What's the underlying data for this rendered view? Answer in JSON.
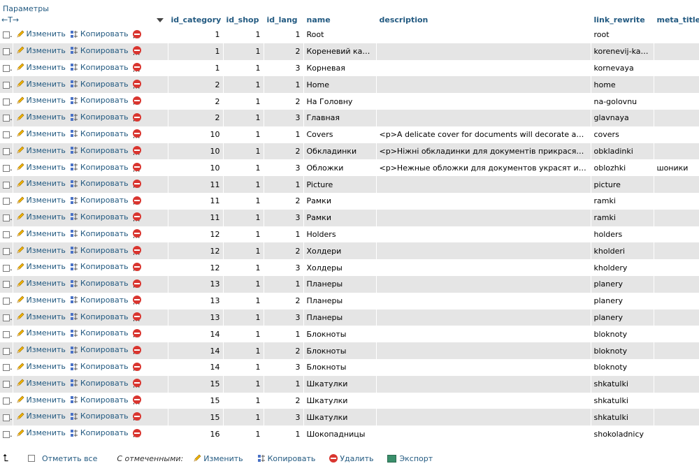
{
  "header": {
    "options_label": "Параметры",
    "resize_arrows": "←T→"
  },
  "columns": [
    "id_category",
    "id_shop",
    "id_lang",
    "name",
    "description",
    "link_rewrite",
    "meta_title"
  ],
  "actions": {
    "edit": "Изменить",
    "copy": "Копировать",
    "delete": "Удалить"
  },
  "rows": [
    {
      "id_category": "1",
      "id_shop": "1",
      "id_lang": "1",
      "name": "Root",
      "description": "",
      "link_rewrite": "root",
      "meta_title": ""
    },
    {
      "id_category": "1",
      "id_shop": "1",
      "id_lang": "2",
      "name": "Кореневий каталог",
      "description": "",
      "link_rewrite": "korenevij-katalog",
      "meta_title": ""
    },
    {
      "id_category": "1",
      "id_shop": "1",
      "id_lang": "3",
      "name": "Корневая",
      "description": "",
      "link_rewrite": "kornevaya",
      "meta_title": ""
    },
    {
      "id_category": "2",
      "id_shop": "1",
      "id_lang": "1",
      "name": "Home",
      "description": "",
      "link_rewrite": "home",
      "meta_title": ""
    },
    {
      "id_category": "2",
      "id_shop": "1",
      "id_lang": "2",
      "name": "На Головну",
      "description": "",
      "link_rewrite": "na-golovnu",
      "meta_title": ""
    },
    {
      "id_category": "2",
      "id_shop": "1",
      "id_lang": "3",
      "name": "Главная",
      "description": "",
      "link_rewrite": "glavnaya",
      "meta_title": ""
    },
    {
      "id_category": "10",
      "id_shop": "1",
      "id_lang": "1",
      "name": "Covers",
      "description": "<p>A delicate cover for documents will decorate an...",
      "link_rewrite": "covers",
      "meta_title": ""
    },
    {
      "id_category": "10",
      "id_shop": "1",
      "id_lang": "2",
      "name": "Обкладинки",
      "description": "<p>Ніжні обкладинки для документів прикрасять і за...",
      "link_rewrite": "obkladinki",
      "meta_title": ""
    },
    {
      "id_category": "10",
      "id_shop": "1",
      "id_lang": "3",
      "name": "Обложки",
      "description": "<p>Нежные обложки для документов украсят и защитят...",
      "link_rewrite": "oblozhki",
      "meta_title": "шоники"
    },
    {
      "id_category": "11",
      "id_shop": "1",
      "id_lang": "1",
      "name": "Picture",
      "description": "",
      "link_rewrite": "picture",
      "meta_title": ""
    },
    {
      "id_category": "11",
      "id_shop": "1",
      "id_lang": "2",
      "name": "Рамки",
      "description": "",
      "link_rewrite": "ramki",
      "meta_title": ""
    },
    {
      "id_category": "11",
      "id_shop": "1",
      "id_lang": "3",
      "name": "Рамки",
      "description": "",
      "link_rewrite": "ramki",
      "meta_title": ""
    },
    {
      "id_category": "12",
      "id_shop": "1",
      "id_lang": "1",
      "name": "Holders",
      "description": "",
      "link_rewrite": "holders",
      "meta_title": ""
    },
    {
      "id_category": "12",
      "id_shop": "1",
      "id_lang": "2",
      "name": "Холдери",
      "description": "",
      "link_rewrite": "kholderi",
      "meta_title": ""
    },
    {
      "id_category": "12",
      "id_shop": "1",
      "id_lang": "3",
      "name": "Холдеры",
      "description": "",
      "link_rewrite": "kholdery",
      "meta_title": ""
    },
    {
      "id_category": "13",
      "id_shop": "1",
      "id_lang": "1",
      "name": "Планеры",
      "description": "",
      "link_rewrite": "planery",
      "meta_title": ""
    },
    {
      "id_category": "13",
      "id_shop": "1",
      "id_lang": "2",
      "name": "Планеры",
      "description": "",
      "link_rewrite": "planery",
      "meta_title": ""
    },
    {
      "id_category": "13",
      "id_shop": "1",
      "id_lang": "3",
      "name": "Планеры",
      "description": "",
      "link_rewrite": "planery",
      "meta_title": ""
    },
    {
      "id_category": "14",
      "id_shop": "1",
      "id_lang": "1",
      "name": "Блокноты",
      "description": "",
      "link_rewrite": "bloknoty",
      "meta_title": ""
    },
    {
      "id_category": "14",
      "id_shop": "1",
      "id_lang": "2",
      "name": "Блокноты",
      "description": "",
      "link_rewrite": "bloknoty",
      "meta_title": ""
    },
    {
      "id_category": "14",
      "id_shop": "1",
      "id_lang": "3",
      "name": "Блокноты",
      "description": "",
      "link_rewrite": "bloknoty",
      "meta_title": ""
    },
    {
      "id_category": "15",
      "id_shop": "1",
      "id_lang": "1",
      "name": "Шкатулки",
      "description": "",
      "link_rewrite": "shkatulki",
      "meta_title": ""
    },
    {
      "id_category": "15",
      "id_shop": "1",
      "id_lang": "2",
      "name": "Шкатулки",
      "description": "",
      "link_rewrite": "shkatulki",
      "meta_title": ""
    },
    {
      "id_category": "15",
      "id_shop": "1",
      "id_lang": "3",
      "name": "Шкатулки",
      "description": "",
      "link_rewrite": "shkatulki",
      "meta_title": ""
    },
    {
      "id_category": "16",
      "id_shop": "1",
      "id_lang": "1",
      "name": "Шокопадницы",
      "description": "",
      "link_rewrite": "shokoladnicy",
      "meta_title": ""
    }
  ],
  "bottom": {
    "check_all": "Отметить все",
    "with_selected": "С отмеченными:",
    "edit": "Изменить",
    "copy": "Копировать",
    "delete": "Удалить",
    "export": "Экспорт"
  },
  "colors": {
    "link": "#235a81",
    "row_even": "#e5e5e5",
    "delete": "#d9352f"
  }
}
